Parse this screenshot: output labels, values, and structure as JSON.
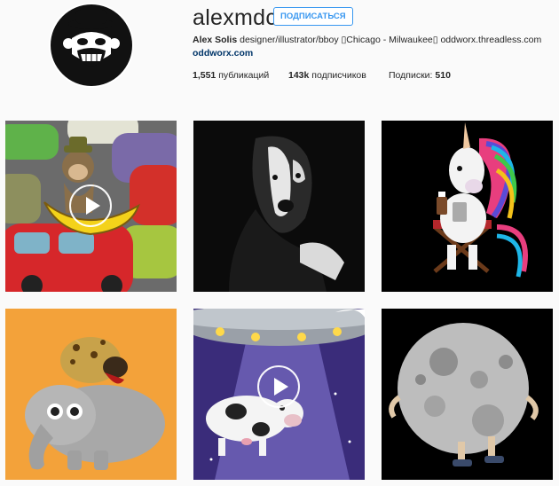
{
  "profile": {
    "username": "alexmdc",
    "follow_label": "ПОДПИСАТЬСЯ",
    "full_name": "Alex Solis",
    "bio": "designer/illustrator/bboy ▯Chicago - Milwaukee▯ oddworx.threadless.com",
    "website": "oddworx.com",
    "posts_count": "1,551",
    "posts_label": "публикаций",
    "followers_count": "143k",
    "followers_label": "подписчиков",
    "following_label": "Подписки:",
    "following_count": "510"
  },
  "posts": [
    {
      "subject": "monkey-on-banana-in-traffic",
      "is_video": true
    },
    {
      "subject": "pitbull-dog-portrait",
      "is_video": false
    },
    {
      "subject": "unicorn-with-coffee-in-chair",
      "is_video": false
    },
    {
      "subject": "hyena-on-elephant",
      "is_video": false
    },
    {
      "subject": "cow-abducted-by-ufo",
      "is_video": true
    },
    {
      "subject": "moon-with-legs",
      "is_video": false
    }
  ],
  "colors": {
    "link": "#003569",
    "follow_accent": "#3897f0",
    "background": "#fafafa"
  }
}
